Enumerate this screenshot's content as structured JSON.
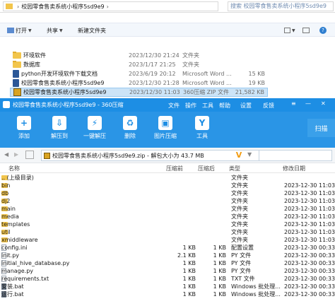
{
  "explorer": {
    "path_parts": [
      "校园零食售卖系统小程序5sd9e9"
    ],
    "search_placeholder": "搜索 校园零食售卖系统小程序5sd9e9",
    "toolbar": {
      "open": "打开",
      "share": "共享",
      "new_folder": "新建文件夹"
    },
    "files": [
      {
        "name": "环境软件",
        "date": "2023/12/30 21:24",
        "type": "文件夹",
        "size": "",
        "icon": "folder"
      },
      {
        "name": "数据库",
        "date": "2023/1/17 21:25",
        "type": "文件夹",
        "size": "",
        "icon": "folder"
      },
      {
        "name": "python开发环境软件下载文档",
        "date": "2023/6/19 20:12",
        "type": "Microsoft Word ...",
        "size": "15 KB",
        "icon": "word-doc"
      },
      {
        "name": "校园零食售卖系统小程序5sd9e9",
        "date": "2023/12/30 21:28",
        "type": "Microsoft Word ...",
        "size": "19 KB",
        "icon": "word-doc"
      },
      {
        "name": "校园零食售卖系统小程序5sd9e9",
        "date": "2023/12/30 11:03",
        "type": "360压缩 ZIP 文件",
        "size": "21,582 KB",
        "icon": "zip",
        "selected": true
      }
    ]
  },
  "zip": {
    "title": "校园零食售卖系统小程序5sd9e9 - 360压缩",
    "menu": [
      "文件",
      "操作",
      "工具",
      "帮助",
      "设置",
      "反馈"
    ],
    "ribbon": [
      {
        "label": "添加",
        "icon": "add-icon"
      },
      {
        "label": "解压到",
        "icon": "extract-icon"
      },
      {
        "label": "一键解压",
        "icon": "one-click-extract-icon"
      },
      {
        "label": "删除",
        "icon": "delete-icon"
      },
      {
        "label": "图片压缩",
        "icon": "image-compress-icon"
      },
      {
        "label": "工具",
        "icon": "tools-icon"
      }
    ],
    "scan_label": "扫描",
    "path": "校园零食售卖系统小程序5sd9e9.zip - 解包大小为 43.7 MB",
    "columns": {
      "name": "名称",
      "orig": "压缩前",
      "comp": "压缩后",
      "type": "类型",
      "date": "修改日期"
    },
    "rows": [
      {
        "name": ".. (上级目录)",
        "orig": "",
        "comp": "",
        "type": "文件夹",
        "date": "",
        "icon": "folder"
      },
      {
        "name": "bin",
        "orig": "",
        "comp": "",
        "type": "文件夹",
        "date": "2023-12-30 11:03",
        "icon": "folder"
      },
      {
        "name": "db",
        "orig": "",
        "comp": "",
        "type": "文件夹",
        "date": "2023-12-30 11:03",
        "icon": "folder"
      },
      {
        "name": "dj2",
        "orig": "",
        "comp": "",
        "type": "文件夹",
        "date": "2023-12-30 11:03",
        "icon": "folder"
      },
      {
        "name": "main",
        "orig": "",
        "comp": "",
        "type": "文件夹",
        "date": "2023-12-30 11:03",
        "icon": "folder"
      },
      {
        "name": "media",
        "orig": "",
        "comp": "",
        "type": "文件夹",
        "date": "2023-12-30 11:03",
        "icon": "folder"
      },
      {
        "name": "templates",
        "orig": "",
        "comp": "",
        "type": "文件夹",
        "date": "2023-12-30 11:03",
        "icon": "folder"
      },
      {
        "name": "util",
        "orig": "",
        "comp": "",
        "type": "文件夹",
        "date": "2023-12-30 11:03",
        "icon": "folder"
      },
      {
        "name": "xmiddleware",
        "orig": "",
        "comp": "",
        "type": "文件夹",
        "date": "2023-12-30 11:03",
        "icon": "folder"
      },
      {
        "name": "config.ini",
        "orig": "1 KB",
        "comp": "1 KB",
        "type": "配置设置",
        "date": "2023-12-30 00:33",
        "icon": "file"
      },
      {
        "name": "init.py",
        "orig": "2.1 KB",
        "comp": "1 KB",
        "type": "PY 文件",
        "date": "2023-12-30 00:33",
        "icon": "file"
      },
      {
        "name": "initial_hive_database.py",
        "orig": "1 KB",
        "comp": "1 KB",
        "type": "PY 文件",
        "date": "2023-12-30 00:33",
        "icon": "file"
      },
      {
        "name": "manage.py",
        "orig": "1 KB",
        "comp": "1 KB",
        "type": "PY 文件",
        "date": "2023-12-30 00:33",
        "icon": "file"
      },
      {
        "name": "requirements.txt",
        "orig": "1 KB",
        "comp": "1 KB",
        "type": "TXT 文件",
        "date": "2023-12-30 00:33",
        "icon": "file"
      },
      {
        "name": "安装.bat",
        "orig": "1 KB",
        "comp": "1 KB",
        "type": "Windows 批处理...",
        "date": "2023-12-30 00:33",
        "icon": "bat"
      },
      {
        "name": "运行.bat",
        "orig": "1 KB",
        "comp": "1 KB",
        "type": "Windows 批处理...",
        "date": "2023-12-30 00:33",
        "icon": "bat"
      }
    ]
  }
}
